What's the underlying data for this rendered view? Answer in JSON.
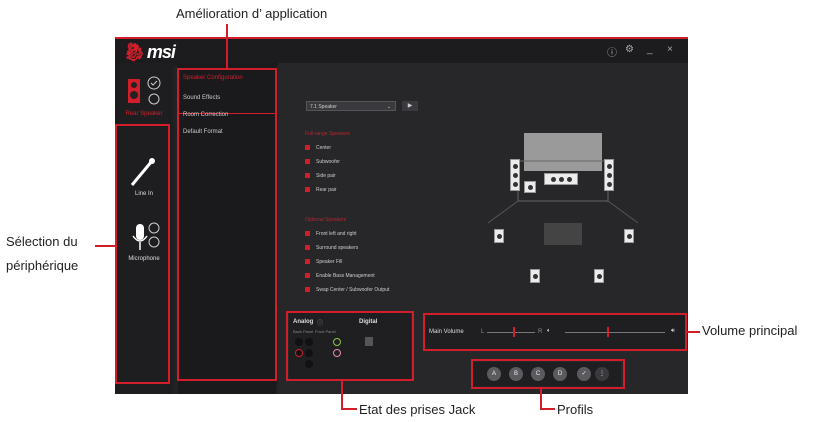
{
  "callouts": {
    "app_enhancement": "Amélioration d’ application",
    "device_selection_1": "Sélection du",
    "device_selection_2": "périphérique",
    "main_volume": "Volume principal",
    "jack_status": "Etat des prises Jack",
    "profiles": "Profils"
  },
  "app": {
    "logo": "msi",
    "window_controls": [
      "ⓘ",
      "⚙",
      "_",
      "×"
    ]
  },
  "devices": [
    {
      "label": "Rear Speaker",
      "icon": "speaker-icon",
      "active": true
    },
    {
      "label": "Line In",
      "icon": "line-in-cable-icon",
      "active": false
    },
    {
      "label": "Microphone",
      "icon": "microphone-icon",
      "active": false
    }
  ],
  "menu": [
    {
      "label": "Speaker Configuration",
      "active": true
    },
    {
      "label": "Sound Effects",
      "active": false
    },
    {
      "label": "Room Correction",
      "active": false
    },
    {
      "label": "Default Format",
      "active": false
    }
  ],
  "speaker_config": {
    "dropdown_value": "7.1 Speaker",
    "play_label": "▶",
    "fullrange_header": "Full-range Speakers",
    "fullrange_options": [
      "Center",
      "Subwoofer",
      "Side pair",
      "Rear pair"
    ],
    "optional_header": "Optional Speakers",
    "optional_options": [
      "Front left and right",
      "Surround speakers",
      "Speaker Fill",
      "Enable Bass Management",
      "Swap Center / Subwoofer Output"
    ]
  },
  "jack": {
    "analog_label": "Analog",
    "digital_label": "Digital",
    "back_panel": "Back Panel",
    "front_panel": "Front Panel"
  },
  "volume": {
    "label": "Main Volume",
    "left_marker": "L",
    "right_marker": "R",
    "left_level": 0.55,
    "right_level": 0.55
  },
  "profiles": [
    "A",
    "B",
    "C",
    "D"
  ],
  "colors": {
    "accent": "#d21e2b",
    "background": "#27272a",
    "jack_green": "#8cc63f",
    "jack_pink": "#e88ab0"
  }
}
